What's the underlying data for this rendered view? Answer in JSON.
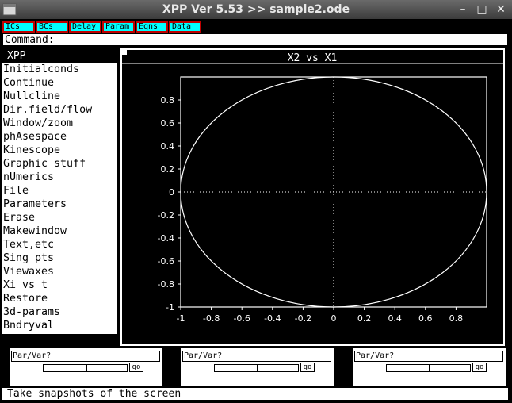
{
  "window": {
    "title": "XPP Ver 5.53 >> sample2.ode",
    "buttons": [
      "–",
      "□",
      "✕"
    ]
  },
  "toolbar": {
    "buttons": [
      "ICs",
      "BCs",
      "Delay",
      "Param",
      "Eqns",
      "Data"
    ]
  },
  "command": {
    "label": "Command:"
  },
  "menu": {
    "header": "XPP",
    "items": [
      "Initialconds",
      "Continue",
      "Nullcline",
      "Dir.field/flow",
      "Window/zoom",
      "phAsespace",
      "Kinescope",
      "Graphic stuff",
      "nUmerics",
      "File",
      "Parameters",
      "Erase",
      "Makewindow",
      "Text,etc",
      "Sing pts",
      "Viewaxes",
      "Xi vs t",
      "Restore",
      "3d-params",
      "Bndryval"
    ]
  },
  "graph": {
    "title": "X2 vs X1"
  },
  "chart_data": {
    "type": "line",
    "title": "X2 vs X1",
    "xlim": [
      -1,
      1
    ],
    "ylim": [
      -1,
      1
    ],
    "xticks": [
      "-1",
      "-0.8",
      "-0.6",
      "-0.4",
      "-0.2",
      "0",
      "0.2",
      "0.4",
      "0.6",
      "0.8"
    ],
    "yticks": [
      "0.8",
      "0.6",
      "0.4",
      "0.2",
      "0",
      "-0.2",
      "-0.4",
      "-0.6",
      "-0.8",
      "-1"
    ],
    "series": [
      {
        "curve": "circle",
        "radius": 1,
        "center": [
          0,
          0
        ]
      }
    ],
    "zero_axes": "dotted",
    "colors": {
      "background": "#000000",
      "line": "#ffffff"
    }
  },
  "sliders": [
    {
      "label": "Par/Var?",
      "go": "go",
      "value": 0.5
    },
    {
      "label": "Par/Var?",
      "go": "go",
      "value": 0.5
    },
    {
      "label": "Par/Var?",
      "go": "go",
      "value": 0.5
    }
  ],
  "status": {
    "text": "Take snapshots of the screen"
  },
  "colors": {
    "toolbar_button": "#00ffff",
    "toolbar_border": "#c00000"
  }
}
